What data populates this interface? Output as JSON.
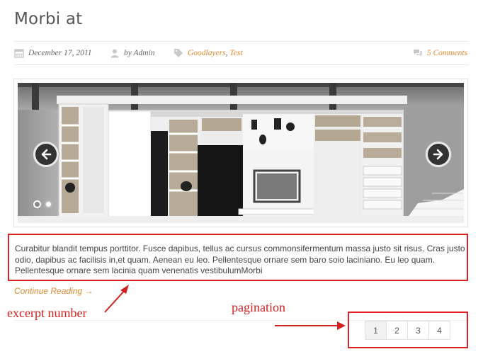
{
  "post": {
    "title": "Morbi at",
    "date": "December 17, 2011",
    "author": "by Admin",
    "tags": [
      "Goodlayers",
      "Test"
    ],
    "tag_separator": ", ",
    "comments": "5 Comments",
    "excerpt": "Curabitur blandit tempus porttitor. Fusce dapibus, tellus ac cursus commonsifermentum massa justo sit risus. Cras justo odio, dapibus ac facilisis in,et quam. Aenean eu leo. Pellentesque ornare sem baro soio laciniano. Eu leo quam. Pellentesque ornare sem lacinia quam venenatis vestibulumMorbi",
    "continue_label": "Continue Reading →"
  },
  "slider": {
    "image": "interior-bookshelf-room",
    "prev_icon": "arrow-left-icon",
    "next_icon": "arrow-right-icon",
    "dot_count": 2,
    "active_dot": 2
  },
  "pagination": {
    "pages": [
      "1",
      "2",
      "3",
      "4"
    ],
    "current": "1"
  },
  "annotations": {
    "excerpt_label": "excerpt number",
    "pagination_label": "pagination",
    "color": "#d02020"
  },
  "colors": {
    "accent": "#e08a2e",
    "annotation_red": "#e02020"
  }
}
